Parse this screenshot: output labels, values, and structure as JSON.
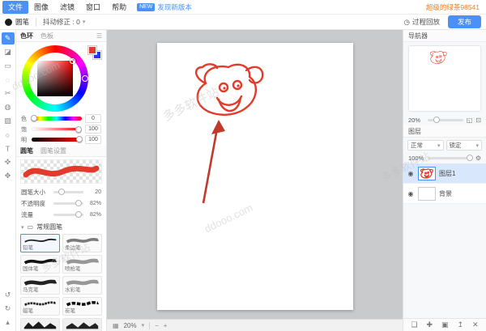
{
  "watermarks": {
    "domain": "ddooo.com",
    "site": "多多软件站"
  },
  "menubar": {
    "items": [
      "文件",
      "图像",
      "滤镜",
      "窗口",
      "帮助"
    ],
    "new_badge": "NEW",
    "update_text": "发现新版本",
    "username": "超级的绿茶98541"
  },
  "toolbar": {
    "tool_name": "圆笔",
    "stabilizer_label": "抖动修正 : 0",
    "replay_label": "过程回放",
    "publish_label": "发布"
  },
  "icons": {
    "chevron_down": "▾",
    "hamburger": "☰",
    "clock": "◷",
    "grid": "▦",
    "minus": "−",
    "plus": "+",
    "eye": "◉",
    "gear": "⚙",
    "fit": "◱",
    "actual": "⊡",
    "undo": "↺",
    "redo": "↻",
    "collapse": "▴"
  },
  "tools": [
    {
      "name": "brush",
      "glyph": "✎"
    },
    {
      "name": "eraser",
      "glyph": "◪"
    },
    {
      "name": "marquee",
      "glyph": "▭"
    },
    {
      "name": "lasso",
      "glyph": "◌"
    },
    {
      "name": "crop",
      "glyph": "✂"
    },
    {
      "name": "fill",
      "glyph": "◍"
    },
    {
      "name": "gradient",
      "glyph": "▨"
    },
    {
      "name": "shape",
      "glyph": "○"
    },
    {
      "name": "text",
      "glyph": "T"
    },
    {
      "name": "eyedropper",
      "glyph": "✜"
    },
    {
      "name": "hand",
      "glyph": "✥"
    }
  ],
  "color_panel": {
    "tabs": [
      "色环",
      "色板"
    ],
    "sliders": [
      {
        "label": "色",
        "value": "0"
      },
      {
        "label": "饱",
        "value": "100"
      },
      {
        "label": "明",
        "value": "100"
      }
    ]
  },
  "brush_panel": {
    "tabs": [
      "圆笔",
      "圆笔设置"
    ],
    "params": [
      {
        "label": "圆笔大小",
        "value": "20"
      },
      {
        "label": "不透明度",
        "value": "82%"
      },
      {
        "label": "流量",
        "value": "82%"
      }
    ],
    "section_title": "常规圆笔",
    "brushes": [
      "铅笔",
      "柔边笔",
      "固体笔",
      "喷枪笔",
      "马克笔",
      "水彩笔",
      "蜡笔",
      "炭笔"
    ]
  },
  "statusbar": {
    "zoom": "20%"
  },
  "navigator": {
    "title": "导航器",
    "zoom": "20%"
  },
  "layers_panel": {
    "title": "图层",
    "blend_value": "正常",
    "lock_label": "锁定",
    "opacity": "100%",
    "layers": [
      {
        "name": "图层1"
      },
      {
        "name": "背景"
      }
    ],
    "bottom_icons": [
      {
        "name": "new-layer",
        "glyph": "❏"
      },
      {
        "name": "add",
        "glyph": "✚"
      },
      {
        "name": "folder",
        "glyph": "▣"
      },
      {
        "name": "merge-up",
        "glyph": "↥"
      },
      {
        "name": "delete",
        "glyph": "✕"
      }
    ]
  }
}
